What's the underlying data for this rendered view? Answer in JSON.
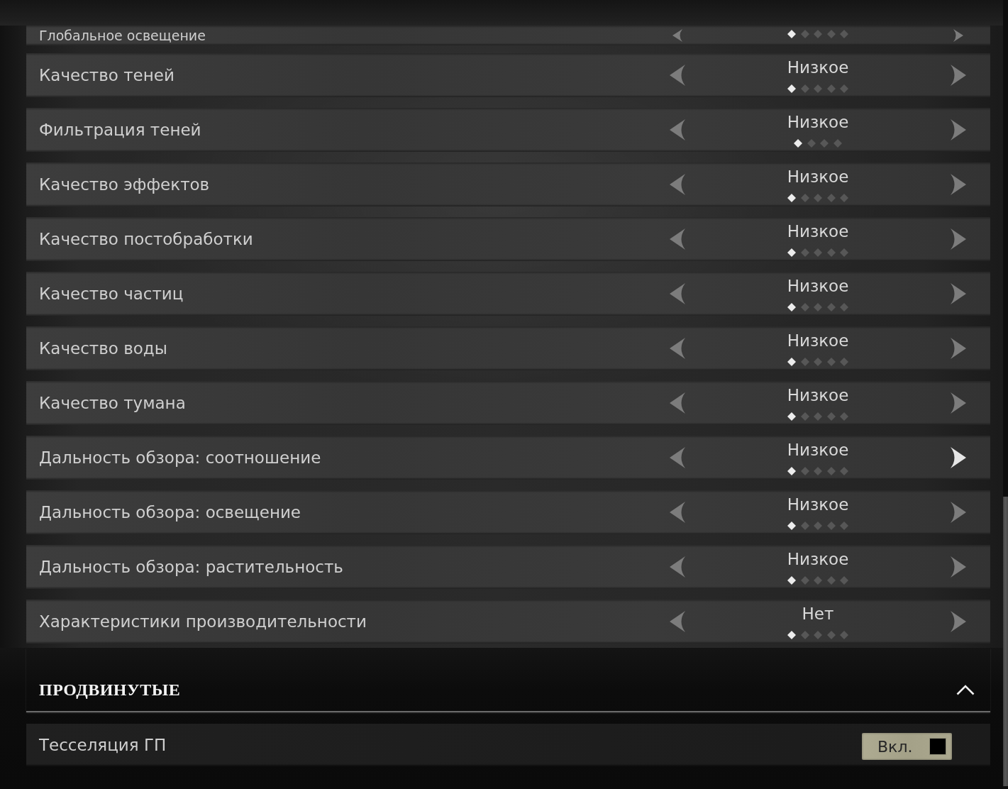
{
  "rows": [
    {
      "kind": "clipped",
      "label": "Глобальное освещение",
      "dots": [
        {
          "selected": true
        },
        {
          "selected": false
        },
        {
          "selected": false
        },
        {
          "selected": false
        },
        {
          "selected": false
        }
      ],
      "next_highlighted": false
    },
    {
      "kind": "selector",
      "label": "Качество теней",
      "value": "Низкое",
      "dots": [
        {
          "selected": true
        },
        {
          "selected": false
        },
        {
          "selected": false
        },
        {
          "selected": false
        },
        {
          "selected": false
        }
      ],
      "next_highlighted": false
    },
    {
      "kind": "selector",
      "label": "Фильтрация теней",
      "value": "Низкое",
      "dots": [
        {
          "selected": true
        },
        {
          "selected": false
        },
        {
          "selected": false
        },
        {
          "selected": false
        }
      ],
      "next_highlighted": false
    },
    {
      "kind": "selector",
      "label": "Качество эффектов",
      "value": "Низкое",
      "dots": [
        {
          "selected": true
        },
        {
          "selected": false
        },
        {
          "selected": false
        },
        {
          "selected": false
        },
        {
          "selected": false
        }
      ],
      "next_highlighted": false
    },
    {
      "kind": "selector",
      "label": "Качество постобработки",
      "value": "Низкое",
      "dots": [
        {
          "selected": true
        },
        {
          "selected": false
        },
        {
          "selected": false
        },
        {
          "selected": false
        },
        {
          "selected": false
        }
      ],
      "next_highlighted": false
    },
    {
      "kind": "selector",
      "label": "Качество частиц",
      "value": "Низкое",
      "dots": [
        {
          "selected": true
        },
        {
          "selected": false
        },
        {
          "selected": false
        },
        {
          "selected": false
        },
        {
          "selected": false
        }
      ],
      "next_highlighted": false
    },
    {
      "kind": "selector",
      "label": "Качество воды",
      "value": "Низкое",
      "dots": [
        {
          "selected": true
        },
        {
          "selected": false
        },
        {
          "selected": false
        },
        {
          "selected": false
        },
        {
          "selected": false
        }
      ],
      "next_highlighted": false
    },
    {
      "kind": "selector",
      "label": "Качество тумана",
      "value": "Низкое",
      "dots": [
        {
          "selected": true
        },
        {
          "selected": false
        },
        {
          "selected": false
        },
        {
          "selected": false
        },
        {
          "selected": false
        }
      ],
      "next_highlighted": false
    },
    {
      "kind": "selector",
      "label": "Дальность обзора: соотношение",
      "value": "Низкое",
      "dots": [
        {
          "selected": true
        },
        {
          "selected": false
        },
        {
          "selected": false
        },
        {
          "selected": false
        },
        {
          "selected": false
        }
      ],
      "next_highlighted": true
    },
    {
      "kind": "selector",
      "label": "Дальность обзора: освещение",
      "value": "Низкое",
      "dots": [
        {
          "selected": true
        },
        {
          "selected": false
        },
        {
          "selected": false
        },
        {
          "selected": false
        },
        {
          "selected": false
        }
      ],
      "next_highlighted": false
    },
    {
      "kind": "selector",
      "label": "Дальность обзора: растительность",
      "value": "Низкое",
      "dots": [
        {
          "selected": true
        },
        {
          "selected": false
        },
        {
          "selected": false
        },
        {
          "selected": false
        },
        {
          "selected": false
        }
      ],
      "next_highlighted": false
    },
    {
      "kind": "selector",
      "label": "Характеристики производительности",
      "value": "Нет",
      "dots": [
        {
          "selected": true
        },
        {
          "selected": false
        },
        {
          "selected": false
        },
        {
          "selected": false
        },
        {
          "selected": false
        }
      ],
      "next_highlighted": false
    }
  ],
  "section": {
    "title": "ПРОДВИНУТЫЕ",
    "expanded": true,
    "rows": [
      {
        "kind": "toggle",
        "label": "Тесселяция ГП",
        "toggle_label": "Вкл.",
        "checked": true
      }
    ]
  }
}
